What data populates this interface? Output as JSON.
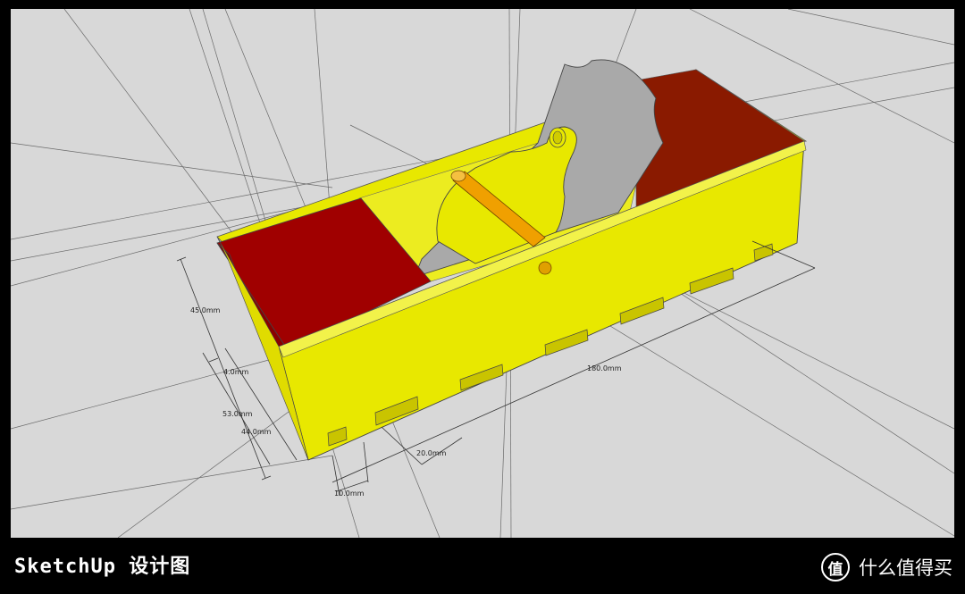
{
  "caption": "SketchUp 设计图",
  "watermark": {
    "text": "什么值得买",
    "logo_glyph": "值",
    "icon": "smzdm-logo-icon"
  },
  "model": {
    "colors": {
      "body": "#e8e800",
      "body_shade": "#c9c400",
      "end_block": "#a00000",
      "end_block_dark": "#8a0000",
      "blade": "#a9a9a9",
      "pin": "#f0a000",
      "background": "#d8d8d8",
      "axis_line": "#555555"
    }
  },
  "dimensions": {
    "height_outer": "45.0mm",
    "wall": "4.0mm",
    "total_height": "53.0mm",
    "inner_height": "44.0mm",
    "length": "180.0mm",
    "joint_spacing": "20.0mm",
    "joint_width": "10.0mm"
  }
}
